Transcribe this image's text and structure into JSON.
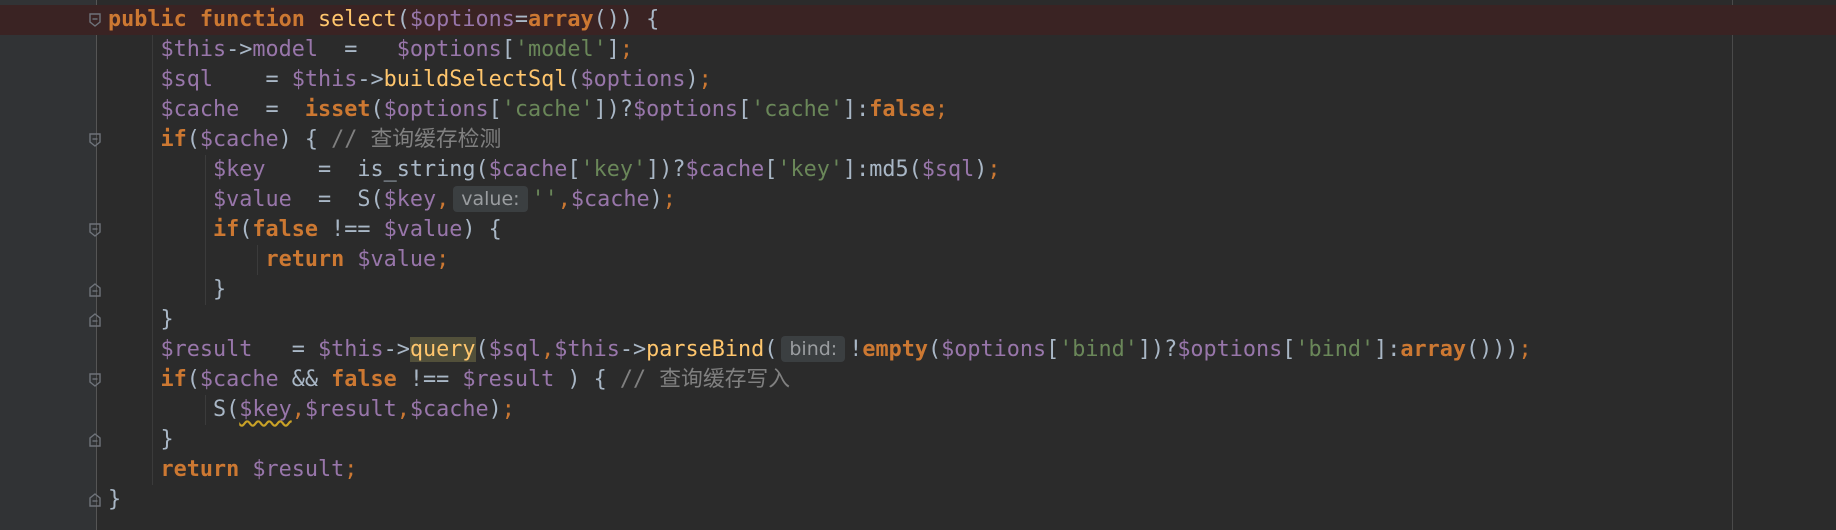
{
  "editor": {
    "language": "PHP",
    "lines": [
      {
        "id": "l1",
        "segments": [
          {
            "c": "kw",
            "t": "public "
          },
          {
            "c": "kw",
            "t": "function "
          },
          {
            "c": "fn",
            "t": "select"
          },
          {
            "c": "plain",
            "t": "("
          },
          {
            "c": "var",
            "t": "$options"
          },
          {
            "c": "plain",
            "t": "="
          },
          {
            "c": "kw",
            "t": "array"
          },
          {
            "c": "plain",
            "t": "()) {"
          }
        ]
      },
      {
        "id": "l2",
        "segments": [
          {
            "c": "plain",
            "t": "    "
          },
          {
            "c": "var",
            "t": "$this"
          },
          {
            "c": "plain",
            "t": "->"
          },
          {
            "c": "var",
            "t": "model"
          },
          {
            "c": "plain",
            "t": "  =   "
          },
          {
            "c": "var",
            "t": "$options"
          },
          {
            "c": "plain",
            "t": "["
          },
          {
            "c": "str",
            "t": "'model'"
          },
          {
            "c": "plain",
            "t": "]"
          },
          {
            "c": "kwn",
            "t": ";"
          }
        ]
      },
      {
        "id": "l3",
        "segments": [
          {
            "c": "plain",
            "t": "    "
          },
          {
            "c": "var",
            "t": "$sql"
          },
          {
            "c": "plain",
            "t": "    = "
          },
          {
            "c": "var",
            "t": "$this"
          },
          {
            "c": "plain",
            "t": "->"
          },
          {
            "c": "fn",
            "t": "buildSelectSql"
          },
          {
            "c": "plain",
            "t": "("
          },
          {
            "c": "var",
            "t": "$options"
          },
          {
            "c": "plain",
            "t": ")"
          },
          {
            "c": "kwn",
            "t": ";"
          }
        ]
      },
      {
        "id": "l4",
        "segments": [
          {
            "c": "plain",
            "t": "    "
          },
          {
            "c": "var",
            "t": "$cache"
          },
          {
            "c": "plain",
            "t": "  =  "
          },
          {
            "c": "kw",
            "t": "isset"
          },
          {
            "c": "plain",
            "t": "("
          },
          {
            "c": "var",
            "t": "$options"
          },
          {
            "c": "plain",
            "t": "["
          },
          {
            "c": "str",
            "t": "'cache'"
          },
          {
            "c": "plain",
            "t": "])?"
          },
          {
            "c": "var",
            "t": "$options"
          },
          {
            "c": "plain",
            "t": "["
          },
          {
            "c": "str",
            "t": "'cache'"
          },
          {
            "c": "plain",
            "t": "]:"
          },
          {
            "c": "kw",
            "t": "false"
          },
          {
            "c": "kwn",
            "t": ";"
          }
        ]
      },
      {
        "id": "l5",
        "segments": [
          {
            "c": "plain",
            "t": "    "
          },
          {
            "c": "kw",
            "t": "if"
          },
          {
            "c": "plain",
            "t": "("
          },
          {
            "c": "var",
            "t": "$cache"
          },
          {
            "c": "plain",
            "t": ") { "
          },
          {
            "c": "cmt",
            "t": "// 查询缓存检测"
          }
        ]
      },
      {
        "id": "l6",
        "segments": [
          {
            "c": "plain",
            "t": "        "
          },
          {
            "c": "var",
            "t": "$key"
          },
          {
            "c": "plain",
            "t": "    =  is_string("
          },
          {
            "c": "var",
            "t": "$cache"
          },
          {
            "c": "plain",
            "t": "["
          },
          {
            "c": "str",
            "t": "'key'"
          },
          {
            "c": "plain",
            "t": "])?"
          },
          {
            "c": "var",
            "t": "$cache"
          },
          {
            "c": "plain",
            "t": "["
          },
          {
            "c": "str",
            "t": "'key'"
          },
          {
            "c": "plain",
            "t": "]:md5("
          },
          {
            "c": "var",
            "t": "$sql"
          },
          {
            "c": "plain",
            "t": ")"
          },
          {
            "c": "kwn",
            "t": ";"
          }
        ]
      },
      {
        "id": "l7",
        "segments": [
          {
            "c": "plain",
            "t": "        "
          },
          {
            "c": "var",
            "t": "$value"
          },
          {
            "c": "plain",
            "t": "  =  S("
          },
          {
            "c": "var",
            "t": "$key"
          },
          {
            "c": "kwn",
            "t": ","
          },
          {
            "c": "hint",
            "t": "value:"
          },
          {
            "c": "str",
            "t": "''"
          },
          {
            "c": "kwn",
            "t": ","
          },
          {
            "c": "var",
            "t": "$cache"
          },
          {
            "c": "plain",
            "t": ")"
          },
          {
            "c": "kwn",
            "t": ";"
          }
        ]
      },
      {
        "id": "l8",
        "segments": [
          {
            "c": "plain",
            "t": "        "
          },
          {
            "c": "kw",
            "t": "if"
          },
          {
            "c": "plain",
            "t": "("
          },
          {
            "c": "kw",
            "t": "false"
          },
          {
            "c": "plain",
            "t": " !== "
          },
          {
            "c": "var",
            "t": "$value"
          },
          {
            "c": "plain",
            "t": ") {"
          }
        ]
      },
      {
        "id": "l9",
        "segments": [
          {
            "c": "plain",
            "t": "            "
          },
          {
            "c": "kw",
            "t": "return "
          },
          {
            "c": "var",
            "t": "$value"
          },
          {
            "c": "kwn",
            "t": ";"
          }
        ]
      },
      {
        "id": "l10",
        "segments": [
          {
            "c": "plain",
            "t": "        }"
          }
        ]
      },
      {
        "id": "l11",
        "segments": [
          {
            "c": "plain",
            "t": "    }"
          }
        ]
      },
      {
        "id": "l12",
        "segments": [
          {
            "c": "plain",
            "t": "    "
          },
          {
            "c": "var",
            "t": "$result"
          },
          {
            "c": "plain",
            "t": "   = "
          },
          {
            "c": "var",
            "t": "$this"
          },
          {
            "c": "plain",
            "t": "->"
          },
          {
            "c": "fn hl-query",
            "t": "query"
          },
          {
            "c": "plain",
            "t": "("
          },
          {
            "c": "var",
            "t": "$sql"
          },
          {
            "c": "kwn",
            "t": ","
          },
          {
            "c": "var",
            "t": "$this"
          },
          {
            "c": "plain",
            "t": "->"
          },
          {
            "c": "fn",
            "t": "parseBind"
          },
          {
            "c": "plain",
            "t": "("
          },
          {
            "c": "hint",
            "t": "bind:"
          },
          {
            "c": "plain",
            "t": "!"
          },
          {
            "c": "kw",
            "t": "empty"
          },
          {
            "c": "plain",
            "t": "("
          },
          {
            "c": "var",
            "t": "$options"
          },
          {
            "c": "plain",
            "t": "["
          },
          {
            "c": "str",
            "t": "'bind'"
          },
          {
            "c": "plain",
            "t": "])?"
          },
          {
            "c": "var",
            "t": "$options"
          },
          {
            "c": "plain",
            "t": "["
          },
          {
            "c": "str",
            "t": "'bind'"
          },
          {
            "c": "plain",
            "t": "]:"
          },
          {
            "c": "kw",
            "t": "array"
          },
          {
            "c": "plain",
            "t": "()))"
          },
          {
            "c": "kwn",
            "t": ";"
          }
        ]
      },
      {
        "id": "l13",
        "segments": [
          {
            "c": "plain",
            "t": "    "
          },
          {
            "c": "kw",
            "t": "if"
          },
          {
            "c": "plain",
            "t": "("
          },
          {
            "c": "var",
            "t": "$cache"
          },
          {
            "c": "plain",
            "t": " && "
          },
          {
            "c": "kw",
            "t": "false"
          },
          {
            "c": "plain",
            "t": " !== "
          },
          {
            "c": "var",
            "t": "$result"
          },
          {
            "c": "plain",
            "t": " ) { "
          },
          {
            "c": "cmt",
            "t": "// 查询缓存写入"
          }
        ]
      },
      {
        "id": "l14",
        "segments": [
          {
            "c": "plain",
            "t": "        S("
          },
          {
            "c": "var squiggle",
            "t": "$key"
          },
          {
            "c": "kwn",
            "t": ","
          },
          {
            "c": "var",
            "t": "$result"
          },
          {
            "c": "kwn",
            "t": ","
          },
          {
            "c": "var",
            "t": "$cache"
          },
          {
            "c": "plain",
            "t": ")"
          },
          {
            "c": "kwn",
            "t": ";"
          }
        ]
      },
      {
        "id": "l15",
        "segments": [
          {
            "c": "plain",
            "t": "    }"
          }
        ]
      },
      {
        "id": "l16",
        "segments": [
          {
            "c": "plain",
            "t": "    "
          },
          {
            "c": "kw",
            "t": "return "
          },
          {
            "c": "var",
            "t": "$result"
          },
          {
            "c": "kwn",
            "t": ";"
          }
        ]
      },
      {
        "id": "l17",
        "segments": [
          {
            "c": "plain",
            "t": "}"
          }
        ]
      }
    ]
  },
  "gutter": {
    "breakpoint_line": 1,
    "breakpoint_icon": "breakpoint-icon",
    "debug_icon": "debug-step-icon",
    "fold_open_icon": "fold-open-icon",
    "fold_close_icon": "fold-close-icon",
    "fold_open_lines": [
      1,
      5,
      8,
      13
    ],
    "fold_close_lines": [
      10,
      11,
      15,
      17
    ]
  },
  "colors": {
    "background": "#2b2b2b",
    "keyword": "#cc7832",
    "variable": "#9876aa",
    "string": "#6a8759",
    "function": "#ffc66d",
    "comment": "#808080",
    "text": "#a9b7c6",
    "breakpoint": "#d23b3b"
  }
}
